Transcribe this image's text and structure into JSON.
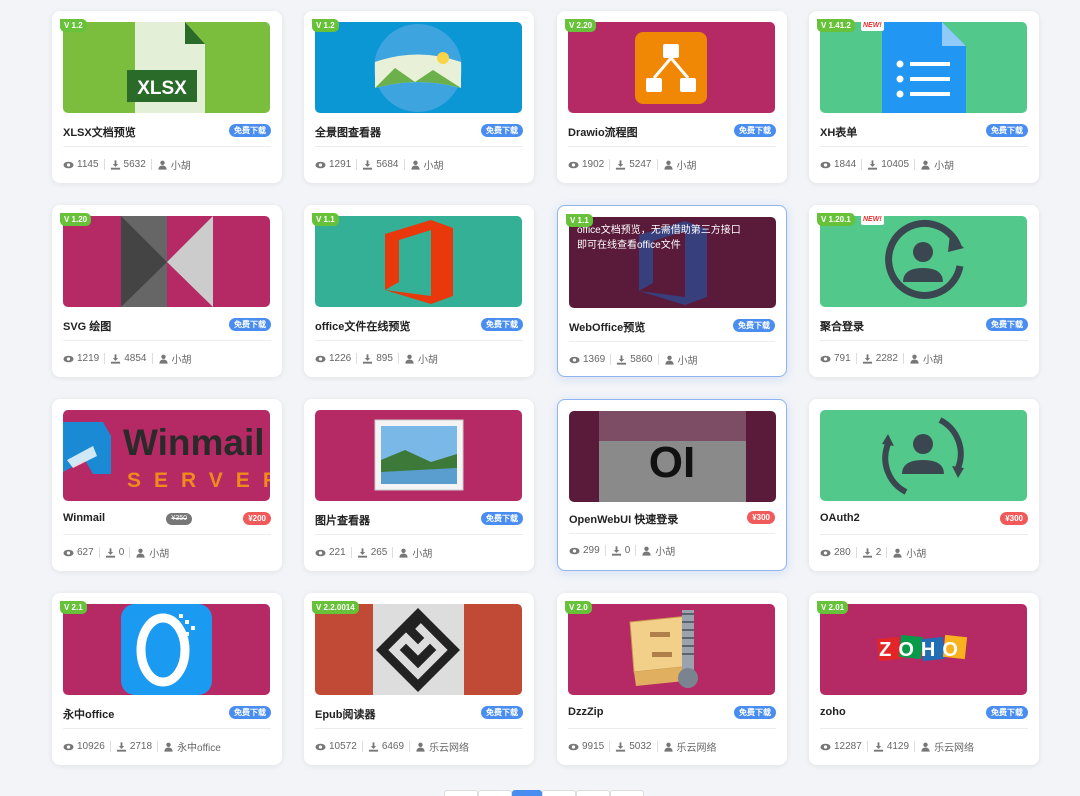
{
  "cards": [
    {
      "title": "XLSX文档预览",
      "version": "V 1.2",
      "price": "免费下载",
      "views": "1145",
      "downloads": "5632",
      "author": "小胡"
    },
    {
      "title": "全景图查看器",
      "version": "V 1.2",
      "price": "免费下载",
      "views": "1291",
      "downloads": "5684",
      "author": "小胡"
    },
    {
      "title": "Drawio流程图",
      "version": "V 2.20",
      "price": "免费下载",
      "views": "1902",
      "downloads": "5247",
      "author": "小胡"
    },
    {
      "title": "XH表单",
      "version": "V 1.41.2",
      "new_badge": "NEW!",
      "price": "免费下载",
      "views": "1844",
      "downloads": "10405",
      "author": "小胡"
    },
    {
      "title": "SVG 绘图",
      "version": "V 1.20",
      "price": "免费下载",
      "views": "1219",
      "downloads": "4854",
      "author": "小胡"
    },
    {
      "title": "office文件在线预览",
      "version": "V 1.1",
      "price": "免费下载",
      "views": "1226",
      "downloads": "895",
      "author": "小胡"
    },
    {
      "title": "WebOffice预览",
      "version": "V 1.1",
      "price": "免费下载",
      "views": "1369",
      "downloads": "5860",
      "author": "小胡",
      "overlay": "office文档预览，无需借助第三方接口即可在线查看office文件"
    },
    {
      "title": "聚合登录",
      "version": "V 1.20.1",
      "new_badge": "NEW!",
      "price": "免费下载",
      "views": "791",
      "downloads": "2282",
      "author": "小胡"
    },
    {
      "title": "Winmail",
      "old_price": "¥350",
      "price": "¥200",
      "views": "627",
      "downloads": "0",
      "author": "小胡",
      "logo_text_1": "Winmail",
      "logo_text_2": "SERVER"
    },
    {
      "title": "图片查看器",
      "price": "免费下载",
      "views": "221",
      "downloads": "265",
      "author": "小胡"
    },
    {
      "title": "OpenWebUI 快速登录",
      "price": "¥300",
      "views": "299",
      "downloads": "0",
      "author": "小胡",
      "logo_text": "OI"
    },
    {
      "title": "OAuth2",
      "price": "¥300",
      "views": "280",
      "downloads": "2",
      "author": "小胡"
    },
    {
      "title": "永中office",
      "version": "V 2.1",
      "price": "免费下载",
      "views": "10926",
      "downloads": "2718",
      "author": "永中office"
    },
    {
      "title": "Epub阅读器",
      "version": "V 2.2.0014",
      "price": "免费下载",
      "views": "10572",
      "downloads": "6469",
      "author": "乐云网络"
    },
    {
      "title": "DzzZip",
      "version": "V 2.0",
      "price": "免费下载",
      "views": "9915",
      "downloads": "5032",
      "author": "乐云网络"
    },
    {
      "title": "zoho",
      "version": "V 2.01",
      "price": "免费下载",
      "views": "12287",
      "downloads": "4129",
      "author": "乐云网络",
      "logo_text": "ZOHO"
    }
  ],
  "xlsx_label": "XLSX",
  "colors": {
    "free": "#4a8df0",
    "paid": "#f05a5a",
    "version": "#67c23a",
    "magenta": "#b52a64",
    "green": "#52c98a"
  }
}
